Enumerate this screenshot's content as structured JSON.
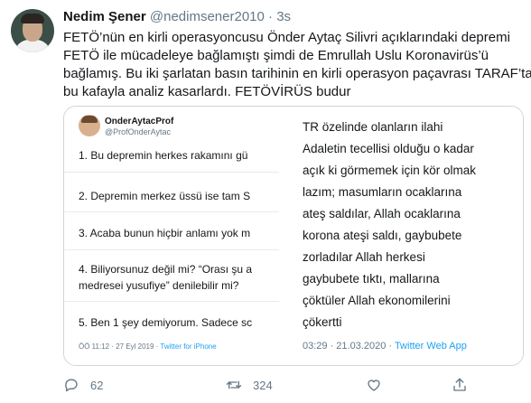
{
  "tweet": {
    "name": "Nedim Şener",
    "handle": "@nedimsener2010",
    "dot": "·",
    "time": "3s",
    "text_lines": [
      "FETÖ’nün en kirli operasyoncusu Önder Aytaç Silivri açıklarındaki depremi",
      "FETÖ ile mücadeleye bağlamıştı şimdi de Emrullah Uslu Koronavirüs’ü",
      "bağlamış. Bu iki şarlatan basın tarihinin en kirli operasyon paçavrası TARAF’ta",
      "bu kafayla analiz kasarlardı. FETÖVİRÜS budur"
    ]
  },
  "media": {
    "left": {
      "name": "OnderAytacProf",
      "handle": "@ProfOnderAytac",
      "lines": [
        "1. Bu depremin herkes rakamını gü",
        "2. Depremin merkez üssü ise tam S",
        "3. Acaba bunun hiçbir anlamı yok m",
        "4. Biliyorsunuz değil mi? “Orası şu a",
        "medresei yusufiye” denilebilir mi?",
        "5. Ben 1 şey demiyorum. Sadece sc"
      ],
      "footer_time": "ÖÖ 11:12 · 27 Eyl 2019 ·",
      "footer_source": "Twitter for iPhone"
    },
    "right": {
      "lines": [
        "TR özelinde olanların ilahi",
        "Adaletin tecellisi olduğu o kadar",
        "açık ki görmemek için kör olmak",
        "lazım; masumların ocaklarına",
        "ateş saldılar, Allah ocaklarına",
        "korona ateşi saldı, gaybubete",
        "zorladılar Allah herkesi",
        "gaybubete tıktı, mallarına",
        "çöktüler Allah ekonomilerini",
        "çökertti"
      ],
      "footer_time": "03:29 · 21.03.2020 ·",
      "footer_source": "Twitter Web App"
    }
  },
  "actions": {
    "reply_count": "62",
    "retweet_count": "324",
    "like_count": "",
    "icons": [
      "reply-icon",
      "retweet-icon",
      "like-icon",
      "share-icon"
    ]
  },
  "colors": {
    "text": "#14171a",
    "secondary": "#657786",
    "accent": "#1da1f2",
    "border": "#ccd6dd"
  }
}
